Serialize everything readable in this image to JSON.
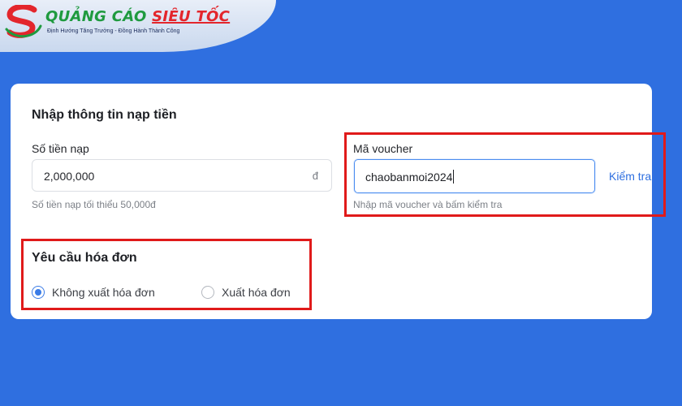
{
  "logo": {
    "title_part1": "QUẢNG CÁO",
    "title_part2": "SIÊU TỐC",
    "tagline": "Định Hướng Tăng Trưởng - Đồng Hành Thành Công",
    "brand_green": "#1f9a3f",
    "brand_red": "#e3262c"
  },
  "form": {
    "title": "Nhập thông tin nạp tiền",
    "amount": {
      "label": "Số tiền nạp",
      "value": "2,000,000",
      "currency": "đ",
      "hint": "Số tiền nạp tối thiểu 50,000đ"
    },
    "voucher": {
      "label": "Mã voucher",
      "value": "chaobanmoi2024",
      "hint": "Nhập mã voucher và bấm kiểm tra",
      "check_label": "Kiểm tra"
    },
    "invoice": {
      "title": "Yêu cầu hóa đơn",
      "options": [
        {
          "label": "Không xuất hóa đơn",
          "selected": true
        },
        {
          "label": "Xuất hóa đơn",
          "selected": false
        }
      ]
    }
  },
  "colors": {
    "background": "#2f6fe0",
    "accent": "#3a7be6",
    "highlight": "#e01a1a"
  }
}
